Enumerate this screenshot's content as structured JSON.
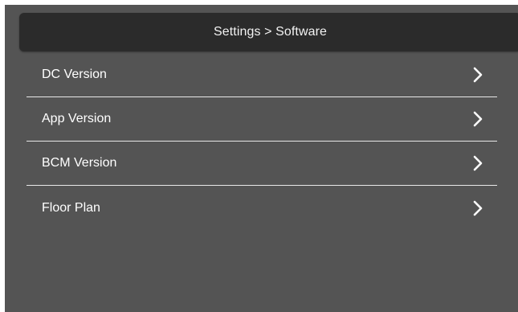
{
  "header": {
    "title": "Settings > Software"
  },
  "menu": {
    "items": [
      {
        "label": "DC Version",
        "icon": "chevron-right-icon"
      },
      {
        "label": "App Version",
        "icon": "chevron-right-icon"
      },
      {
        "label": "BCM Version",
        "icon": "chevron-right-icon"
      },
      {
        "label": "Floor Plan",
        "icon": "chevron-right-icon"
      }
    ]
  },
  "colors": {
    "background": "#545454",
    "header_background": "#2b2b2b",
    "text": "#ffffff",
    "divider": "#e8e8e8"
  }
}
